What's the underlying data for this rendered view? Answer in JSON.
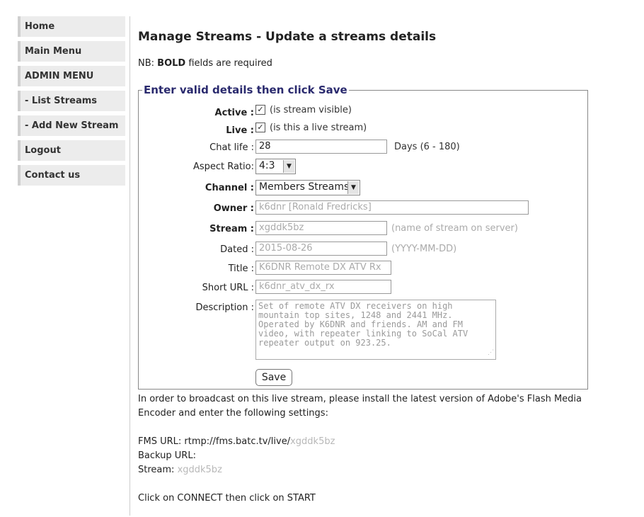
{
  "sidebar": {
    "items": [
      {
        "label": "Home"
      },
      {
        "label": "Main Menu"
      },
      {
        "label": "ADMIN MENU"
      },
      {
        "label": "- List Streams"
      },
      {
        "label": "- Add New Stream"
      },
      {
        "label": "Logout"
      },
      {
        "label": "Contact us"
      }
    ]
  },
  "page": {
    "title": "Manage Streams - Update a streams details",
    "note_prefix": "NB: ",
    "note_bold": "BOLD",
    "note_suffix": " fields are required"
  },
  "form": {
    "legend": "Enter valid details then click Save",
    "active": {
      "label": "Active :",
      "checked": "✓",
      "hint": "(is stream visible)"
    },
    "live": {
      "label": "Live :",
      "checked": "✓",
      "hint": "(is this a live stream)"
    },
    "chat_life": {
      "label": "Chat life :",
      "value": "28",
      "hint": "Days (6 - 180)"
    },
    "aspect_ratio": {
      "label": "Aspect Ratio:",
      "value": "4:3"
    },
    "channel": {
      "label": "Channel :",
      "value": "Members Streams"
    },
    "owner": {
      "label": "Owner :",
      "value": "k6dnr [Ronald Fredricks]"
    },
    "stream": {
      "label": "Stream :",
      "value": "xgddk5bz",
      "hint": "(name of stream on server)"
    },
    "dated": {
      "label": "Dated :",
      "value": "2015-08-26",
      "hint": "(YYYY-MM-DD)"
    },
    "title": {
      "label": "Title :",
      "value": "K6DNR Remote DX ATV Rx"
    },
    "short_url": {
      "label": "Short URL :",
      "value": "k6dnr_atv_dx_rx"
    },
    "description": {
      "label": "Description :",
      "value": "Set of remote ATV DX receivers on high mountain top sites, 1248 and 2441 MHz. Operated by K6DNR and friends. AM and FM video, with repeater linking to SoCal ATV repeater output on 923.25."
    },
    "save_label": "Save"
  },
  "info": {
    "line1": "In order to broadcast on this live stream, please install the latest version of Adobe's Flash Media",
    "line2": "Encoder and enter the following settings:",
    "fms_label": "FMS URL: rtmp://fms.batc.tv/live/",
    "fms_stream": "xgddk5bz",
    "backup_label": "Backup URL:",
    "stream_label": "Stream: ",
    "stream_value": "xgddk5bz",
    "connect": "Click on CONNECT then click on START"
  }
}
